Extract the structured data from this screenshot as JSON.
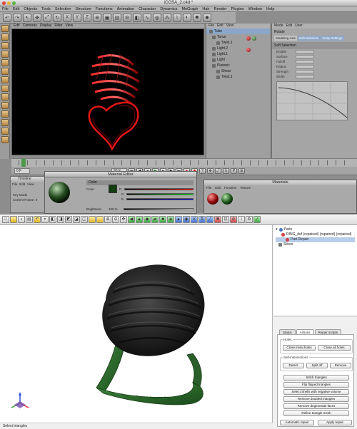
{
  "c4d": {
    "window_title": "iCOSA_2.c4d *",
    "menu": [
      "File",
      "Edit",
      "Objects",
      "Tools",
      "Selection",
      "Structure",
      "Functions",
      "Animation",
      "Character",
      "Dynamics",
      "MoGraph",
      "Hair",
      "Render",
      "Plugins",
      "Window",
      "Help"
    ],
    "viewport_menu": [
      "Edit",
      "Cameras",
      "Display",
      "Filter",
      "View"
    ],
    "object_manager": {
      "menu": [
        "File",
        "Edit",
        "View"
      ],
      "items": [
        "Tube",
        "Torus",
        "Twist.1",
        "Light.2",
        "Light.1",
        "Light",
        "Platonic",
        "Shear",
        "Twist.1"
      ]
    },
    "attributes": {
      "menu": [
        "Mode",
        "Edit",
        "User"
      ],
      "object_title": "Rotate",
      "tabs": [
        "Modeling Axis",
        "Soft Selection",
        "Snap Settings"
      ],
      "section": "Soft Selection",
      "rows": [
        "Enable",
        "Surface",
        "Falloff",
        "Radius",
        "Strength",
        "Width"
      ]
    },
    "transport": {
      "start_frame": "0 F",
      "end_frame": "90 F"
    },
    "timeline_window": {
      "title": "Timeline",
      "menu": [
        "File",
        "Edit",
        "View"
      ],
      "mode_label": "Key Mode",
      "current_frame_label": "Current Frame: 0"
    },
    "material_editor": {
      "title": "Material Editor",
      "section": "Color",
      "color_label": "Color",
      "brightness_label": "Brightness",
      "rgb": [
        "R",
        "G",
        "B"
      ],
      "brightness_value": "100 %"
    },
    "materials_window": {
      "title": "Materials",
      "menu": [
        "File",
        "Edit",
        "Function",
        "Texture"
      ]
    }
  },
  "netfabb": {
    "tree": {
      "root": "Parts",
      "part": "RING_def (repaired) (repaired) (repaired)",
      "child": "Part Repair",
      "slices": "Slices"
    },
    "tabs": [
      "Status",
      "Actions",
      "Repair scripts"
    ],
    "holes_group": "Holes",
    "close_trivial": "Close trivial holes",
    "close_all": "Close all holes",
    "self_intersections_group": "Self-intersections",
    "detect": "Detect",
    "split_off": "Split off",
    "remove": "Remove",
    "actions": [
      "Stitch triangles",
      "Flip flipped triangles",
      "Select Shells with negative volume",
      "Remove doubled triangles",
      "Remove degenerate faces",
      "Refine triangle mesh"
    ],
    "automatic_repair": "Automatic repair",
    "apply_repair": "Apply repair",
    "status_text": "Select triangles",
    "colors": {
      "mesh": "#2c2c2c",
      "ring": "#2f6b2f",
      "accent": "#3c6fd1"
    }
  }
}
